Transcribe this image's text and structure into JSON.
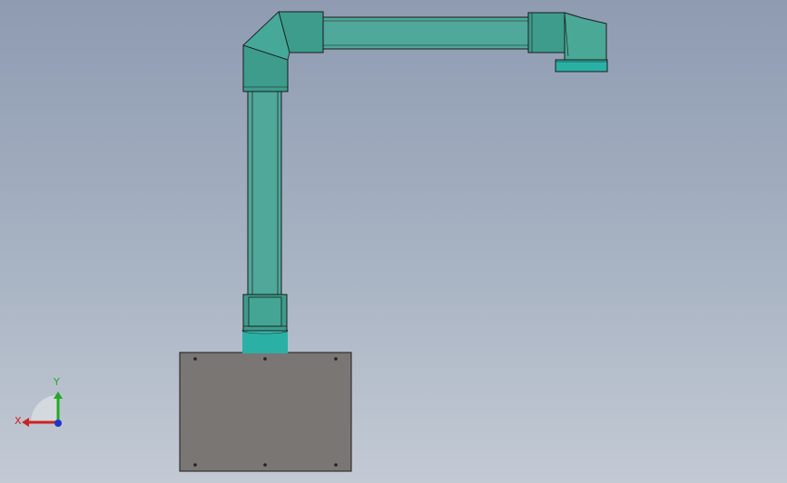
{
  "viewport": {
    "background_top": "#8e9bb1",
    "background_bottom": "#c3cad4"
  },
  "model": {
    "duct_color": "#4fa89a",
    "duct_highlight": "#5cb8a9",
    "fitting_color": "#3d9c8c",
    "collar_color": "#2bb0a6",
    "base_plate_color": "#7a7673",
    "outline_color": "#1a1a1a"
  },
  "triad": {
    "x_label": "X",
    "y_label": "Y",
    "x_color": "#cc2222",
    "y_color": "#22aa22",
    "z_color": "#2233cc"
  }
}
